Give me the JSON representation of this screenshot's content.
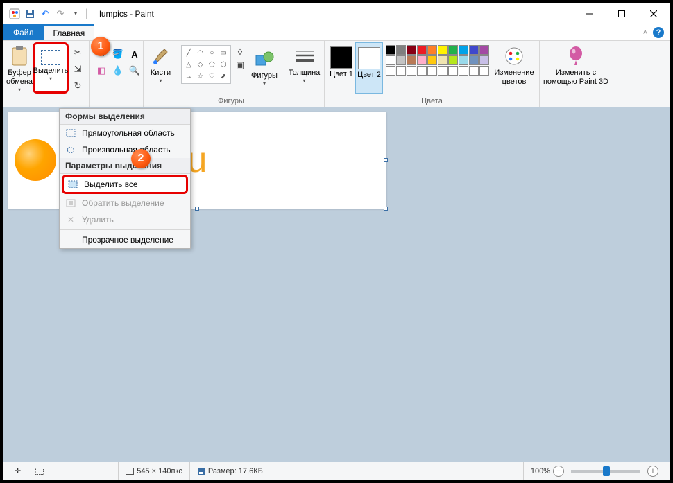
{
  "title": "lumpics - Paint",
  "tabs": {
    "file": "Файл",
    "home": "Главная"
  },
  "ribbon": {
    "clipboard": {
      "label": "Буфер обмена",
      "paste": "Буфер обмена"
    },
    "image": {
      "select": "Выделить"
    },
    "brushes": {
      "label": "Кисти"
    },
    "shapes": {
      "group": "Фигуры",
      "label": "Фигуры"
    },
    "thickness": {
      "label": "Толщина"
    },
    "colors": {
      "group": "Цвета",
      "c1": "Цвет 1",
      "c2": "Цвет 2",
      "edit": "Изменение цветов"
    },
    "paint3d": {
      "label": "Изменить с помощью Paint 3D"
    }
  },
  "dropdown": {
    "section1": "Формы выделения",
    "rect": "Прямоугольная область",
    "free": "Произвольная область",
    "section2": "Параметры выделения",
    "select_all": "Выделить все",
    "invert": "Обратить выделение",
    "delete": "Удалить",
    "transparent": "Прозрачное выделение"
  },
  "canvas": {
    "text": "mpics.ru"
  },
  "status": {
    "dims": "545 × 140пкс",
    "size_label": "Размер: 17,6КБ",
    "zoom": "100%"
  },
  "palette": {
    "row1": [
      "#000000",
      "#7f7f7f",
      "#880015",
      "#ed1c24",
      "#ff7f27",
      "#fff200",
      "#22b14c",
      "#00a2e8",
      "#3f48cc",
      "#a349a4"
    ],
    "row2": [
      "#ffffff",
      "#c3c3c3",
      "#b97a57",
      "#ffaec9",
      "#ffc90e",
      "#efe4b0",
      "#b5e61d",
      "#99d9ea",
      "#7092be",
      "#c8bfe7"
    ],
    "row3": [
      "#fff",
      "#fff",
      "#fff",
      "#fff",
      "#fff",
      "#fff",
      "#fff",
      "#fff",
      "#fff",
      "#fff"
    ]
  },
  "badges": {
    "b1": "1",
    "b2": "2"
  }
}
